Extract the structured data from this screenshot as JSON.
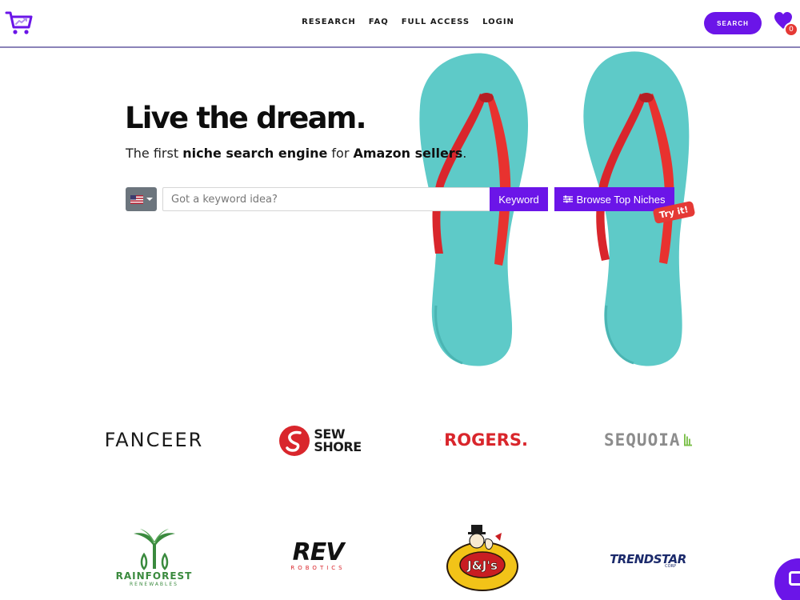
{
  "header": {
    "nav": [
      "RESEARCH",
      "FAQ",
      "FULL ACCESS",
      "LOGIN"
    ],
    "search_button": "SEARCH",
    "favorites_count": "0"
  },
  "hero": {
    "headline": "Live the dream.",
    "sub_prefix": "The first ",
    "sub_bold1": "niche search engine",
    "sub_mid": " for ",
    "sub_bold2": "Amazon sellers",
    "sub_suffix": ".",
    "country_flag": "us-flag-icon",
    "keyword_placeholder": "Got a keyword idea?",
    "keyword_button": "Keyword",
    "browse_button": "Browse Top Niches",
    "try_badge": "Try it!"
  },
  "brands": {
    "fanceer": "FANCEER",
    "sewshore_line1": "SEW",
    "sewshore_line2": "SHORE",
    "rogers": "ROGERS.",
    "sequoia": "SEQUOIA",
    "rainforest_line1": "RAINFOREST",
    "rainforest_line2": "RENEWABLES",
    "rev_line1": "REV",
    "rev_line2": "ROBOTICS",
    "jjs": "J&J's",
    "trendstar": "TRENDSTAR",
    "trendstar_sub": "CORP"
  },
  "colors": {
    "accent": "#6b15e8",
    "badge_red": "#e53935",
    "sandal_teal": "#5ecac8",
    "strap_red": "#d9262c"
  }
}
